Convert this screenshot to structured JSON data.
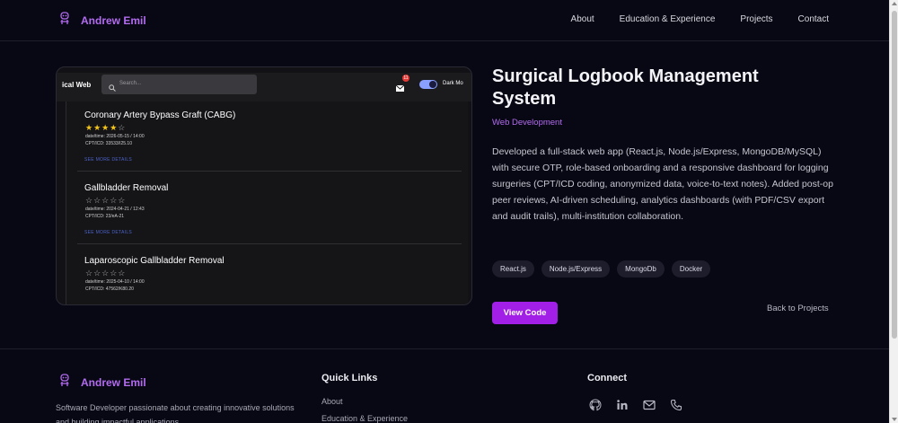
{
  "nav": {
    "brand_icon": "robot-icon",
    "brand": "Andrew Emil",
    "links": [
      "About",
      "Education & Experience",
      "Projects",
      "Contact"
    ]
  },
  "project": {
    "title": "Surgical Logbook Management System",
    "category": "Web Development",
    "description": "Developed a full-stack web app (React.js, Node.js/Express, MongoDB/MySQL) with secure OTP, role-based onboarding and a responsive dashboard for logging surgeries (CPT/ICD coding, anonymized data, voice-to-text notes). Added post-op peer reviews, AI-driven scheduling, analytics dashboards (with PDF/CSV export and audit trails), multi-institution collaboration.",
    "tags": [
      "React.js",
      "Node.js/Express",
      "MongoDb",
      "Docker"
    ],
    "view_code": "View Code",
    "back": "Back to Projects",
    "screenshot": {
      "app_title": "ical Web",
      "search_placeholder": "Search...",
      "badge": "11",
      "mode_label": "Dark Mo",
      "cards": [
        {
          "title": "Coronary Artery Bypass Graft (CABG)",
          "rating": 4,
          "datetime": "date/time: 2026-05-15 / 14:00",
          "codes": "CPT/ICD: 33533/I25.10",
          "link": "SEE MORE DETAILS"
        },
        {
          "title": "Gallbladder Removal",
          "rating": 0,
          "datetime": "date/time: 2024-04-21 / 12:43",
          "codes": "CPT/ICD: 23/eA-21",
          "link": "SEE MORE DETAILS"
        },
        {
          "title": "Laparoscopic Gallbladder Removal",
          "rating": 0,
          "datetime": "date/time: 2025-04-10 / 14:00",
          "codes": "CPT/ICD: 47562/K80.20",
          "link": ""
        }
      ]
    }
  },
  "footer": {
    "brand": "Andrew Emil",
    "description": "Software Developer passionate about creating innovative solutions and building impactful applications.",
    "quick_links_title": "Quick Links",
    "quick_links": [
      "About",
      "Education & Experience"
    ],
    "connect_title": "Connect",
    "connect_icons": [
      "github-icon",
      "linkedin-icon",
      "mail-icon",
      "phone-icon"
    ]
  },
  "colors": {
    "background": "#080814",
    "accent": "#b36cf0",
    "button": "#a21fe8"
  }
}
